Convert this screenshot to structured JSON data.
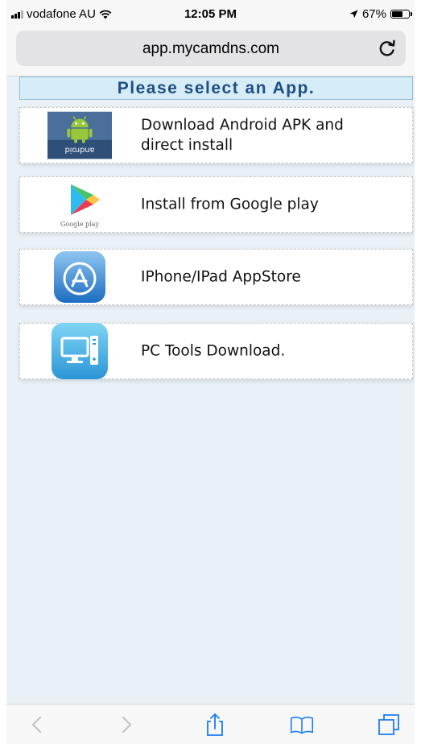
{
  "status_bar": {
    "carrier": "vodafone AU",
    "time": "12:05 PM",
    "battery": "67%",
    "battery_level": 0.67
  },
  "browser": {
    "url": "app.mycamdns.com"
  },
  "page": {
    "heading": "Please select an App.",
    "apps": [
      {
        "label": "Download Android APK and direct install",
        "icon": "android-icon",
        "icon_text": "android"
      },
      {
        "label": "Install from Google play",
        "icon": "google-play-icon",
        "icon_text": "Google play"
      },
      {
        "label": "IPhone/IPad AppStore",
        "icon": "app-store-icon"
      },
      {
        "label": "PC Tools Download.",
        "icon": "pc-tools-icon"
      }
    ]
  },
  "toolbar": {
    "items": [
      "back-icon",
      "forward-icon",
      "share-icon",
      "bookmarks-icon",
      "tabs-icon"
    ]
  },
  "colors": {
    "page_bg": "#e9f1f6",
    "heading_bg": "#d6ecf7",
    "heading_text": "#1d4e86",
    "ios_blue": "#1a7cf5"
  }
}
